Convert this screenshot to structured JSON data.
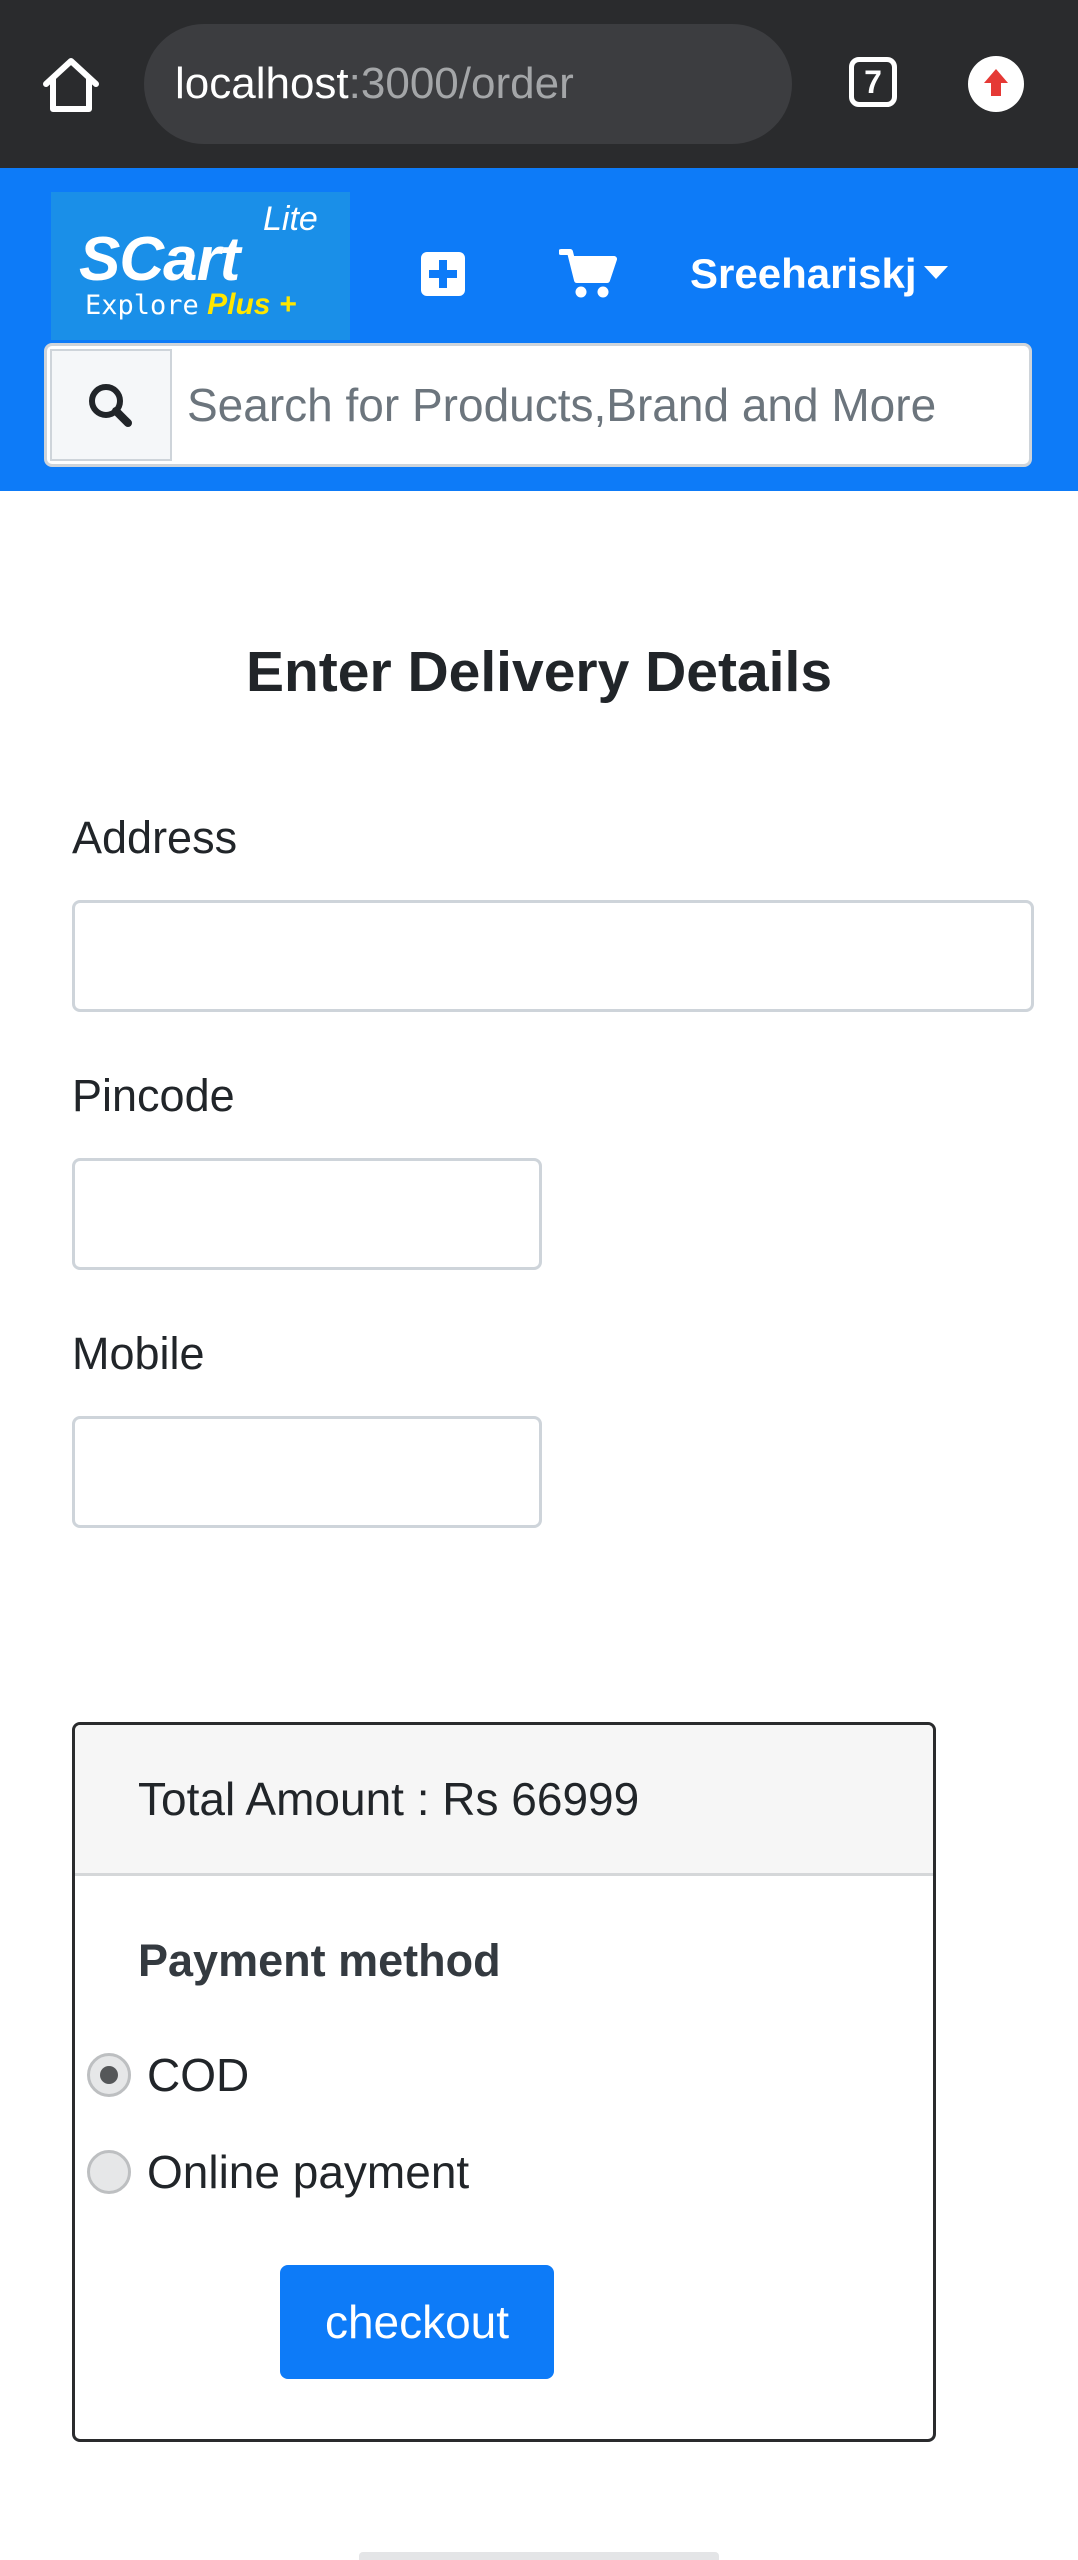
{
  "browser": {
    "url_host": "localhost",
    "url_path": ":3000/order",
    "tab_count": "7",
    "icons": {
      "home": "home-icon",
      "tabs": "tab-switcher-icon",
      "extension": "upload-arrow-icon"
    }
  },
  "navbar": {
    "logo": {
      "lite": "Lite",
      "name": "SCart",
      "tag_explore": "Explore",
      "tag_plus": "Plus +"
    },
    "user_name": "Sreehariskj",
    "search_placeholder": "Search for Products,Brand and More",
    "icons": {
      "add": "plus-square-icon",
      "cart": "shopping-cart-icon",
      "dropdown": "caret-down-icon",
      "search": "search-icon"
    },
    "colors": {
      "bar": "#0d7bf8",
      "logo_bg": "#1a8fe8",
      "plus_accent": "#ffe600"
    }
  },
  "form": {
    "title": "Enter Delivery Details",
    "address_label": "Address",
    "address_value": "",
    "pincode_label": "Pincode",
    "pincode_value": "",
    "mobile_label": "Mobile",
    "mobile_value": ""
  },
  "summary": {
    "total_label": "Total Amount : Rs 66999",
    "payment_title": "Payment method",
    "options": [
      {
        "label": "COD",
        "selected": true
      },
      {
        "label": "Online payment",
        "selected": false
      }
    ],
    "checkout_label": "checkout",
    "colors": {
      "checkout": "#0d7bf8"
    }
  }
}
